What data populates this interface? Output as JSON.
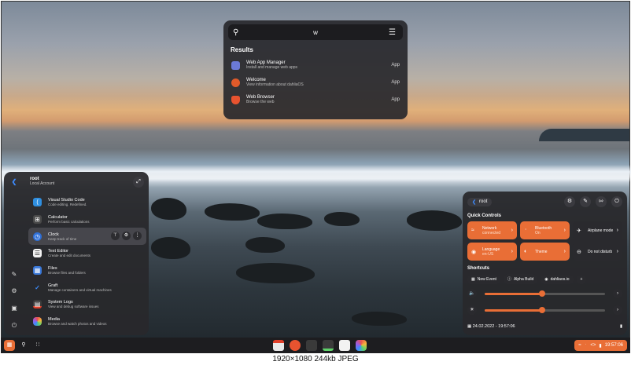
{
  "launcher": {
    "search_value": "w",
    "results_title": "Results",
    "results": [
      {
        "name": "Web App Manager",
        "desc": "Install and manage web apps",
        "kind": "App",
        "color": "#6b7ad6"
      },
      {
        "name": "Welcome",
        "desc": "View information about dahliaOS",
        "kind": "App",
        "color": "#e05a2a"
      },
      {
        "name": "Web Browser",
        "desc": "Browse the web",
        "kind": "App",
        "color": "#e8532f"
      }
    ]
  },
  "appmenu": {
    "user_name": "root",
    "user_type": "Local Account",
    "apps": [
      {
        "name": "Visual Studio Code",
        "desc": "Code editing. Redefined.",
        "color": "#2f8fe0",
        "icon": "vscode-icon"
      },
      {
        "name": "Calculator",
        "desc": "Perform basic calculations",
        "color": "#4a4a4a",
        "icon": "calculator-icon"
      },
      {
        "name": "Clock",
        "desc": "Keep track of time",
        "color": "#2f6fd6",
        "icon": "clock-icon"
      },
      {
        "name": "Text Editor",
        "desc": "Create and edit documents",
        "color": "#f2f2f2",
        "icon": "text-editor-icon"
      },
      {
        "name": "Files",
        "desc": "Browse files and folders",
        "color": "#3a78d8",
        "icon": "files-icon"
      },
      {
        "name": "Graft",
        "desc": "Manage containers and virtual machines",
        "color": "#2f7fd6",
        "icon": "graft-icon"
      },
      {
        "name": "System Logs",
        "desc": "View and debug software issues",
        "color": "#3b3b3b",
        "icon": "system-logs-icon"
      },
      {
        "name": "Media",
        "desc": "Browse and watch photos and videos",
        "color": "#9b5de5",
        "icon": "media-icon"
      }
    ]
  },
  "quick": {
    "user_name": "root",
    "quick_controls_title": "Quick Controls",
    "tiles": [
      {
        "title": "Network",
        "sub": "connected",
        "on": true,
        "icon": "wifi-icon"
      },
      {
        "title": "Bluetooth",
        "sub": "On",
        "on": true,
        "icon": "bluetooth-icon"
      },
      {
        "title": "Airplane mode",
        "sub": "",
        "on": false,
        "icon": "airplane-icon"
      },
      {
        "title": "Language",
        "sub": "en-US",
        "on": true,
        "icon": "language-icon"
      },
      {
        "title": "Theme",
        "sub": "",
        "on": true,
        "icon": "theme-icon"
      },
      {
        "title": "Do not disturb",
        "sub": "",
        "on": false,
        "icon": "dnd-icon"
      }
    ],
    "shortcuts_title": "Shortcuts",
    "shortcuts": [
      "New Event",
      "Alpha Build",
      "dahliaos.io"
    ],
    "volume_level": 0.48,
    "brightness_level": 0.48,
    "date_time": "24.02.2022 - 19:57:06"
  },
  "taskbar": {
    "clock": "19:57:06",
    "accent": "#e96e36"
  },
  "caption": "1920×1080  244kb  JPEG"
}
